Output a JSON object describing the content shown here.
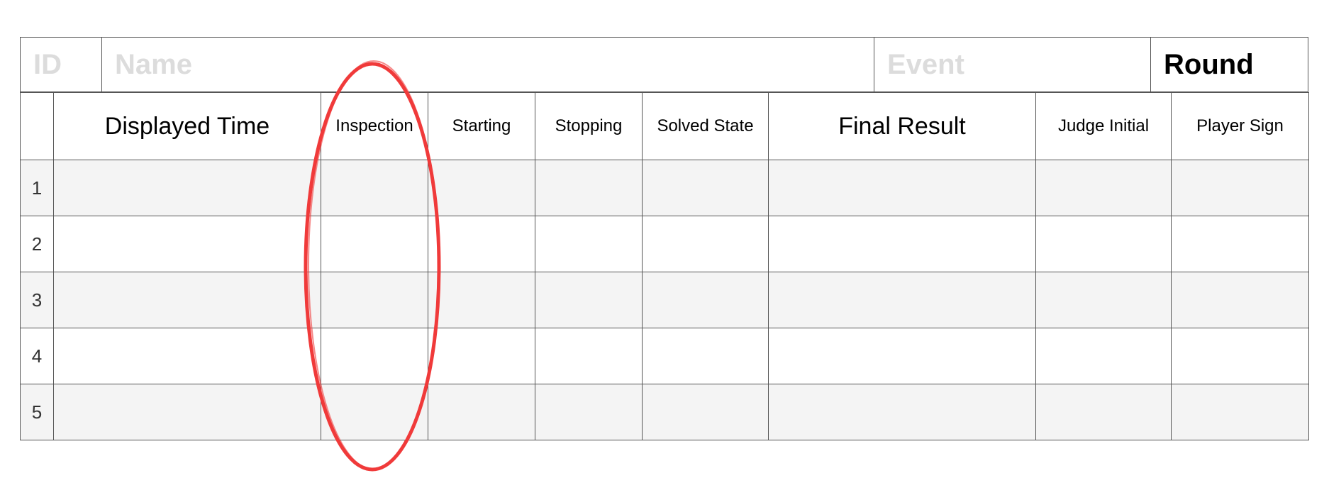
{
  "header": {
    "id_placeholder": "ID",
    "name_placeholder": "Name",
    "event_placeholder": "Event",
    "round_label": "Round"
  },
  "columns": [
    {
      "key": "displayed_time",
      "label": "Displayed Time"
    },
    {
      "key": "inspection",
      "label": "Inspection"
    },
    {
      "key": "starting",
      "label": "Starting"
    },
    {
      "key": "stopping",
      "label": "Stopping"
    },
    {
      "key": "solved_state",
      "label": "Solved State"
    },
    {
      "key": "final_result",
      "label": "Final Result"
    },
    {
      "key": "judge_initial",
      "label": "Judge Initial"
    },
    {
      "key": "player_sign",
      "label": "Player Sign"
    }
  ],
  "rows": [
    "1",
    "2",
    "3",
    "4",
    "5"
  ],
  "annotation": {
    "type": "ellipse",
    "color": "#f03a3a",
    "highlights_column": "inspection"
  }
}
